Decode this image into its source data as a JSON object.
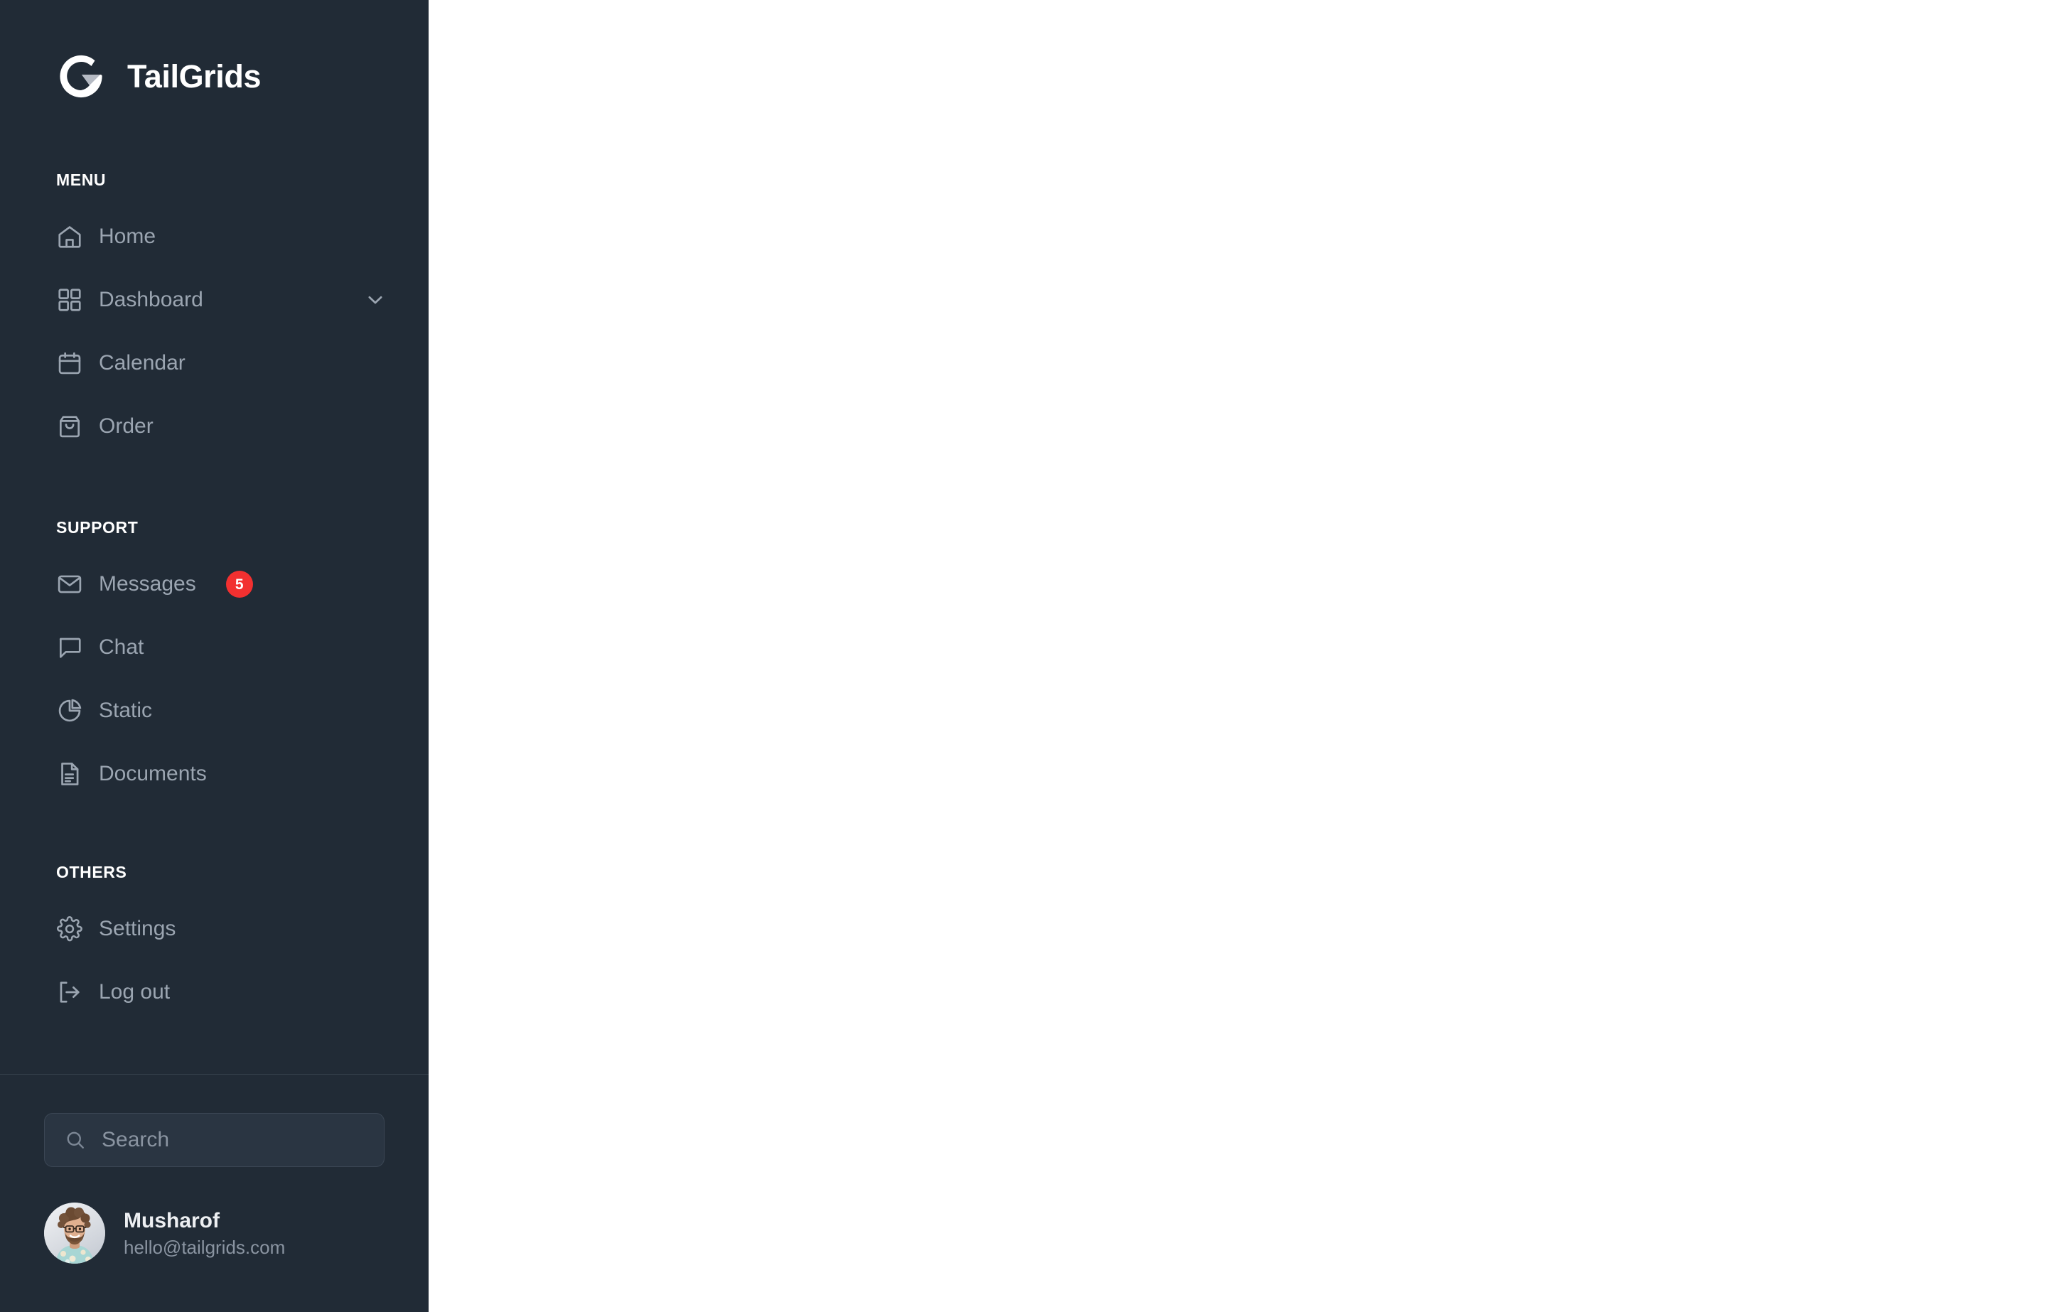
{
  "brand": {
    "name": "TailGrids",
    "logo_icon": "tailgrids-g-logo"
  },
  "sidebar": {
    "sections": [
      {
        "label": "MENU",
        "items": [
          {
            "label": "Home",
            "icon": "home-icon"
          },
          {
            "label": "Dashboard",
            "icon": "grid-icon",
            "chevron": "chevron-down-icon"
          },
          {
            "label": "Calendar",
            "icon": "calendar-icon"
          },
          {
            "label": "Order",
            "icon": "shopping-bag-icon"
          }
        ]
      },
      {
        "label": "SUPPORT",
        "items": [
          {
            "label": "Messages",
            "icon": "envelope-icon",
            "badge": "5"
          },
          {
            "label": "Chat",
            "icon": "chat-bubble-icon"
          },
          {
            "label": "Static",
            "icon": "pie-chart-icon"
          },
          {
            "label": "Documents",
            "icon": "document-text-icon"
          }
        ]
      },
      {
        "label": "OTHERS",
        "items": [
          {
            "label": "Settings",
            "icon": "gear-icon"
          },
          {
            "label": "Log out",
            "icon": "logout-icon"
          }
        ]
      }
    ]
  },
  "search": {
    "placeholder": "Search",
    "value": "",
    "icon": "search-icon"
  },
  "profile": {
    "name": "Musharof",
    "email": "hello@tailgrids.com",
    "avatar_icon": "user-avatar-photo"
  },
  "colors": {
    "sidebar_bg": "#212B36",
    "sidebar_text": "#9BA5B1",
    "sidebar_heading": "#FFFFFF",
    "badge_red": "#F23030",
    "search_bg": "#2A3542",
    "divider": "#36414D",
    "main_bg": "#FFFFFF"
  }
}
